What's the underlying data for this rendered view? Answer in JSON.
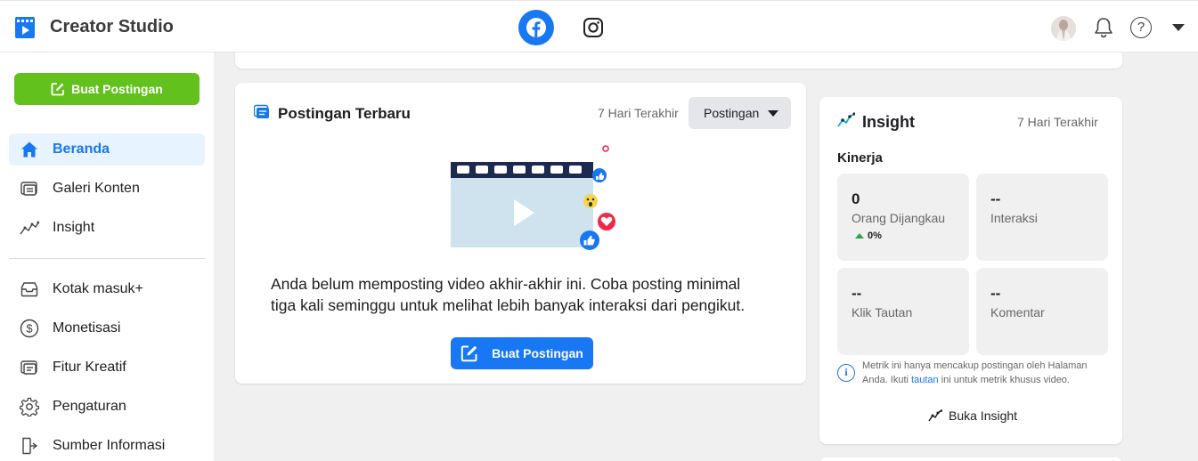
{
  "header": {
    "app_title": "Creator Studio",
    "platforms": [
      {
        "name": "Facebook",
        "icon": "facebook-icon",
        "active": true
      },
      {
        "name": "Instagram",
        "icon": "instagram-icon",
        "active": false
      }
    ],
    "icons": [
      "avatar",
      "bell-icon",
      "help-icon",
      "caret-down-icon"
    ]
  },
  "sidebar": {
    "create_button": "Buat Postingan",
    "items": [
      {
        "label": "Beranda",
        "icon": "home-icon",
        "active": true
      },
      {
        "label": "Galeri Konten",
        "icon": "content-library-icon",
        "active": false
      },
      {
        "label": "Insight",
        "icon": "insights-icon",
        "active": false
      },
      {
        "label": "Kotak masuk+",
        "icon": "inbox-icon",
        "active": false
      },
      {
        "label": "Monetisasi",
        "icon": "dollar-icon",
        "active": false
      },
      {
        "label": "Fitur Kreatif",
        "icon": "creative-tools-icon",
        "active": false
      },
      {
        "label": "Pengaturan",
        "icon": "gear-icon",
        "active": false
      },
      {
        "label": "Sumber Informasi",
        "icon": "resources-icon",
        "active": false
      }
    ]
  },
  "posts_card": {
    "title": "Postingan Terbaru",
    "period": "7 Hari Terakhir",
    "dropdown_value": "Postingan",
    "empty_message": "Anda belum memposting video akhir-akhir ini. Coba posting minimal tiga kali seminggu untuk melihat lebih banyak interaksi dari pengikut.",
    "create_button": "Buat Postingan"
  },
  "insight_card": {
    "title": "Insight",
    "period": "7 Hari Terakhir",
    "section": "Kinerja",
    "metrics": [
      {
        "value": "0",
        "label": "Orang Dijangkau",
        "change": "0%"
      },
      {
        "value": "--",
        "label": "Interaksi"
      },
      {
        "value": "--",
        "label": "Klik Tautan"
      },
      {
        "value": "--",
        "label": "Komentar"
      }
    ],
    "note_before": "Metrik ini hanya mencakup postingan oleh Halaman Anda. Ikuti ",
    "note_link": "tautan",
    "note_after": " ini untuk metrik khusus video.",
    "open_button": "Buka Insight"
  },
  "colors": {
    "brand_blue": "#1877f2",
    "create_green": "#63c11e",
    "active_nav_bg": "#e7f3ff",
    "positive_change": "#31a24c"
  }
}
